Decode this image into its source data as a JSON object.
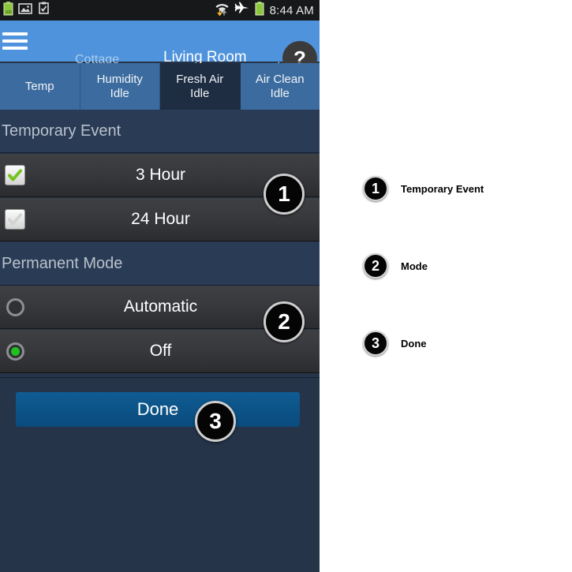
{
  "status_bar": {
    "battery_label": "100%",
    "time": "8:44 AM",
    "icons": [
      "battery-icon",
      "picture-icon",
      "clipboard-check-icon",
      "wifi-transfer-icon",
      "airplane-mode-icon",
      "battery-icon"
    ]
  },
  "header": {
    "menu_icon": "hamburger-menu-icon",
    "home_label": "Cottage",
    "room_label": "Living Room",
    "caret_icon": "dropdown-caret-icon",
    "help_label": "?"
  },
  "tabs": [
    {
      "label": "Temp",
      "status": "",
      "selected": false
    },
    {
      "label": "Humidity",
      "status": "Idle",
      "selected": false
    },
    {
      "label": "Fresh Air",
      "status": "Idle",
      "selected": true
    },
    {
      "label": "Air Clean",
      "status": "Idle",
      "selected": false
    }
  ],
  "sections": [
    {
      "title": "Temporary Event",
      "options": [
        {
          "label": "3 Hour",
          "control": "checkbox",
          "checked": true
        },
        {
          "label": "24 Hour",
          "control": "checkbox",
          "checked": false
        }
      ]
    },
    {
      "title": "Permanent Mode",
      "options": [
        {
          "label": "Automatic",
          "control": "radio",
          "checked": false
        },
        {
          "label": "Off",
          "control": "radio",
          "checked": true
        }
      ]
    }
  ],
  "done_button": {
    "label": "Done"
  },
  "callouts": [
    {
      "number": "1",
      "label": "Temporary Event"
    },
    {
      "number": "2",
      "label": "Mode"
    },
    {
      "number": "3",
      "label": "Done"
    }
  ],
  "colors": {
    "header_blue": "#4f93dc",
    "tab_blue": "#3c6c9f",
    "tab_selected": "#1e2d42",
    "section_navy": "#2a3b55",
    "page_navy": "#253449",
    "row_gray": "#36383c",
    "done_blue": "#0f5c93",
    "accent_green": "#1fc11f",
    "status_bar_black": "#17181a"
  }
}
